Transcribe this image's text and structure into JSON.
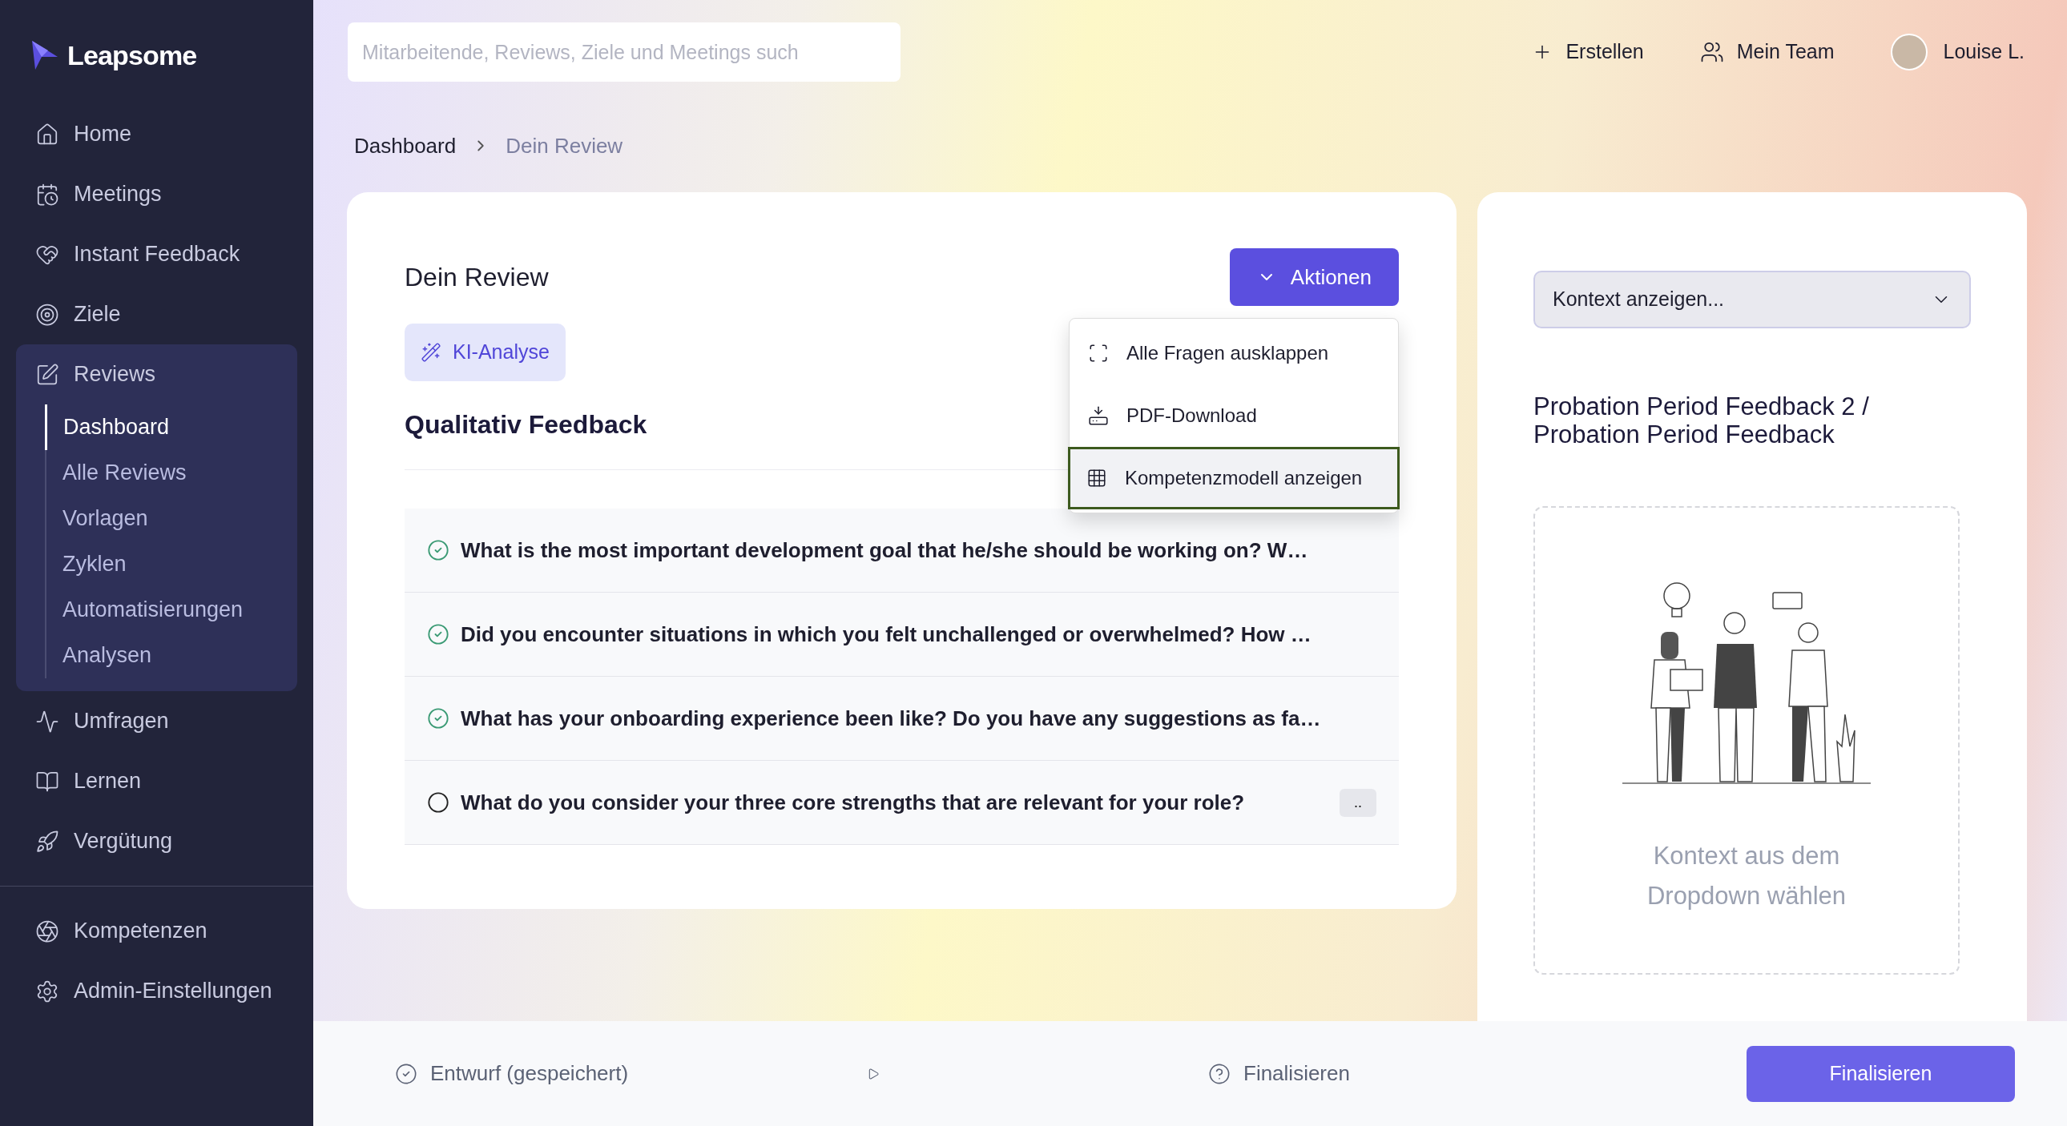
{
  "sidebar": {
    "logo": "Leapsome",
    "items": [
      {
        "label": "Home"
      },
      {
        "label": "Meetings"
      },
      {
        "label": "Instant Feedback"
      },
      {
        "label": "Ziele"
      },
      {
        "label": "Reviews",
        "expanded": true,
        "children": [
          {
            "label": "Dashboard",
            "selected": true
          },
          {
            "label": "Alle Reviews",
            "selected": false
          },
          {
            "label": "Vorlagen",
            "selected": false
          },
          {
            "label": "Zyklen",
            "selected": false
          },
          {
            "label": "Automatisierungen",
            "selected": false
          },
          {
            "label": "Analysen",
            "selected": false
          }
        ]
      },
      {
        "label": "Umfragen"
      },
      {
        "label": "Lernen"
      },
      {
        "label": "Vergütung"
      }
    ],
    "bottom_items": [
      {
        "label": "Kompetenzen"
      },
      {
        "label": "Admin-Einstellungen"
      }
    ]
  },
  "topbar": {
    "search": {
      "placeholder": "Mitarbeitende, Reviews, Ziele und Meetings such"
    },
    "actions": [
      {
        "label": "Erstellen"
      },
      {
        "label": "Mein Team"
      }
    ],
    "user": {
      "name": "Louise L."
    }
  },
  "breadcrumb": [
    {
      "label": "Dashboard"
    },
    {
      "label": "Dein Review"
    }
  ],
  "review": {
    "title": "Dein Review",
    "actions_button": "Aktionen",
    "ai_button": "KI-Analyse",
    "section_title": "Qualitativ Feedback",
    "menu": [
      {
        "label": "Alle Fragen ausklappen",
        "selected": false
      },
      {
        "label": "PDF-Download",
        "selected": false
      },
      {
        "label": "Kompetenzmodell anzeigen",
        "selected": true
      }
    ],
    "questions": [
      {
        "text": "What is the most important development goal that he/she should be working on? W…",
        "answered": true
      },
      {
        "text": "Did you encounter situations in which you felt unchallenged or overwhelmed? How …",
        "answered": true
      },
      {
        "text": "What has your onboarding experience been like? Do you have any suggestions as fa…",
        "answered": true
      },
      {
        "text": "What do you consider your three core strengths that are relevant for your role?",
        "answered": false,
        "badge": ".."
      }
    ]
  },
  "context": {
    "select": {
      "value": "Kontext anzeigen..."
    },
    "title": "Probation Period Feedback 2 / Probation Period Feedback",
    "empty_text": "Kontext aus dem Dropdown wählen"
  },
  "footer": {
    "status": "Entwurf (gespeichert)",
    "help": "Finalisieren",
    "button": "Finalisieren"
  }
}
